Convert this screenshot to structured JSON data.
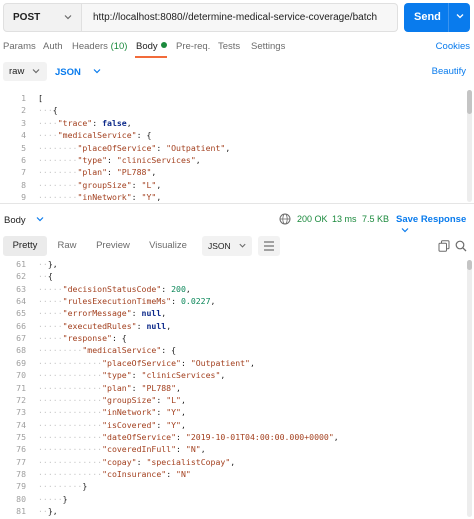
{
  "request": {
    "method": "POST",
    "url": "http://localhost:8080//determine-medical-service-coverage/batch",
    "send_label": "Send"
  },
  "req_tabs": {
    "params": "Params",
    "auth": "Auth",
    "headers": "Headers",
    "headers_count": "(10)",
    "body": "Body",
    "prereq": "Pre-req.",
    "tests": "Tests",
    "settings": "Settings",
    "cookies": "Cookies"
  },
  "body_type": {
    "mode": "raw",
    "language": "JSON",
    "beautify": "Beautify"
  },
  "request_lines": [
    {
      "n": "1",
      "html": "<span>[</span>"
    },
    {
      "n": "2",
      "html": "<span class=\"guide\">···</span>{"
    },
    {
      "n": "3",
      "html": "<span class=\"guide\">····</span><span class=\"str\">\"trace\"</span>: <span class=\"kw\">false</span>,"
    },
    {
      "n": "4",
      "html": "<span class=\"guide\">····</span><span class=\"str\">\"medicalService\"</span>: {"
    },
    {
      "n": "5",
      "html": "<span class=\"guide\">········</span><span class=\"str\">\"placeOfService\"</span>: <span class=\"str\">\"Outpatient\"</span>,"
    },
    {
      "n": "6",
      "html": "<span class=\"guide\">········</span><span class=\"str\">\"type\"</span>: <span class=\"str\">\"clinicServices\"</span>,"
    },
    {
      "n": "7",
      "html": "<span class=\"guide\">········</span><span class=\"str\">\"plan\"</span>: <span class=\"str\">\"PL788\"</span>,"
    },
    {
      "n": "8",
      "html": "<span class=\"guide\">········</span><span class=\"str\">\"groupSize\"</span>: <span class=\"str\">\"L\"</span>,"
    },
    {
      "n": "9",
      "html": "<span class=\"guide\">········</span><span class=\"str\">\"inNetwork\"</span>: <span class=\"str\">\"Y\"</span>,"
    }
  ],
  "response": {
    "label": "Body",
    "status": "200 OK",
    "time": "13 ms",
    "size": "7.5 KB",
    "save_label": "Save Response",
    "views": [
      "Pretty",
      "Raw",
      "Preview",
      "Visualize"
    ],
    "language": "JSON"
  },
  "response_lines": [
    {
      "n": "61",
      "html": "<span class=\"guide\">··</span>},"
    },
    {
      "n": "62",
      "html": "<span class=\"guide\">··</span>{"
    },
    {
      "n": "63",
      "html": "<span class=\"guide\">·····</span><span class=\"str\">\"decisionStatusCode\"</span>: <span class=\"num\">200</span>,"
    },
    {
      "n": "64",
      "html": "<span class=\"guide\">·····</span><span class=\"str\">\"rulesExecutionTimeMs\"</span>: <span class=\"num\">0.0227</span>,"
    },
    {
      "n": "65",
      "html": "<span class=\"guide\">·····</span><span class=\"str\">\"errorMessage\"</span>: <span class=\"kw\">null</span>,"
    },
    {
      "n": "66",
      "html": "<span class=\"guide\">·····</span><span class=\"str\">\"executedRules\"</span>: <span class=\"kw\">null</span>,"
    },
    {
      "n": "67",
      "html": "<span class=\"guide\">·····</span><span class=\"str\">\"response\"</span>: {"
    },
    {
      "n": "68",
      "html": "<span class=\"guide\">·········</span><span class=\"str\">\"medicalService\"</span>: {"
    },
    {
      "n": "69",
      "html": "<span class=\"guide\">·············</span><span class=\"str\">\"placeOfService\"</span>: <span class=\"str\">\"Outpatient\"</span>,"
    },
    {
      "n": "70",
      "html": "<span class=\"guide\">·············</span><span class=\"str\">\"type\"</span>: <span class=\"str\">\"clinicServices\"</span>,"
    },
    {
      "n": "71",
      "html": "<span class=\"guide\">·············</span><span class=\"str\">\"plan\"</span>: <span class=\"str\">\"PL788\"</span>,"
    },
    {
      "n": "72",
      "html": "<span class=\"guide\">·············</span><span class=\"str\">\"groupSize\"</span>: <span class=\"str\">\"L\"</span>,"
    },
    {
      "n": "73",
      "html": "<span class=\"guide\">·············</span><span class=\"str\">\"inNetwork\"</span>: <span class=\"str\">\"Y\"</span>,"
    },
    {
      "n": "74",
      "html": "<span class=\"guide\">·············</span><span class=\"str\">\"isCovered\"</span>: <span class=\"str\">\"Y\"</span>,"
    },
    {
      "n": "75",
      "html": "<span class=\"guide\">·············</span><span class=\"str\">\"dateOfService\"</span>: <span class=\"str\">\"2019-10-01T04:00:00.000+0000\"</span>,"
    },
    {
      "n": "76",
      "html": "<span class=\"guide\">·············</span><span class=\"str\">\"coveredInFull\"</span>: <span class=\"str\">\"N\"</span>,"
    },
    {
      "n": "77",
      "html": "<span class=\"guide\">·············</span><span class=\"str\">\"copay\"</span>: <span class=\"str\">\"specialistCopay\"</span>,"
    },
    {
      "n": "78",
      "html": "<span class=\"guide\">·············</span><span class=\"str\">\"coInsurance\"</span>: <span class=\"str\">\"N\"</span>"
    },
    {
      "n": "79",
      "html": "<span class=\"guide\">·········</span>}"
    },
    {
      "n": "80",
      "html": "<span class=\"guide\">·····</span>}"
    },
    {
      "n": "81",
      "html": "<span class=\"guide\">··</span>},"
    }
  ],
  "colors": {
    "accent": "#097bed",
    "active_tab": "#f26b3a",
    "success": "#1b8a3d"
  },
  "icons": [
    "chevron-down-icon",
    "globe-icon",
    "wrap-lines-icon",
    "copy-icon",
    "search-icon"
  ]
}
